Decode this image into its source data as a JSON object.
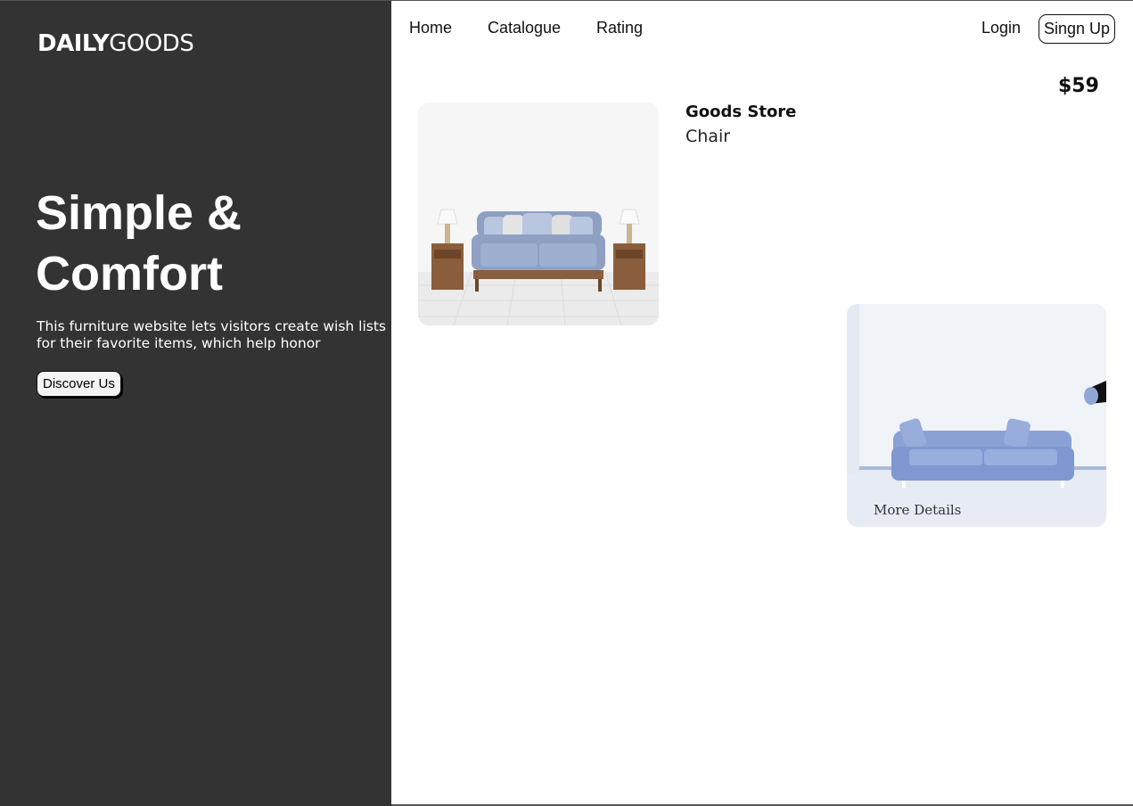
{
  "brand": {
    "bold": "DAILY",
    "light": "GOODS"
  },
  "nav": {
    "home": "Home",
    "catalogue": "Catalogue",
    "rating": "Rating",
    "login": "Login",
    "signup": "Singn Up"
  },
  "hero": {
    "title_line1": "Simple &",
    "title_line2": "Comfort",
    "description": "This furniture website lets visitors create wish lists for their favorite items, which help honor",
    "button": "Discover Us"
  },
  "product": {
    "price": "$59",
    "store": "Goods Store",
    "name": "Chair",
    "more_details": "More Details"
  },
  "colors": {
    "sidebar": "#333333",
    "sofa": "#9aaed4",
    "accent": "#111111"
  }
}
